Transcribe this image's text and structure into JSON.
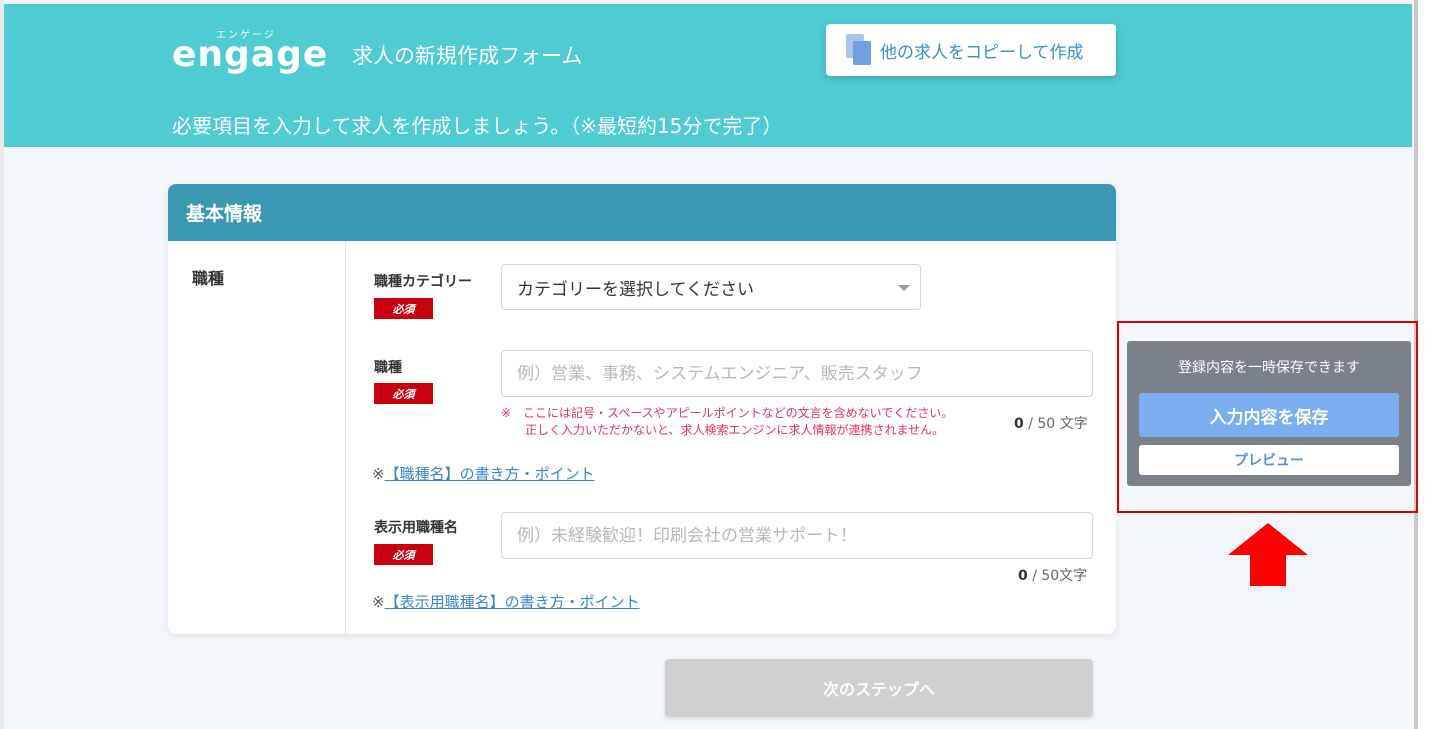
{
  "header": {
    "logo_kana": "エンゲージ",
    "logo_word": "engage",
    "title": "求人の新規作成フォーム",
    "subtitle": "必要項目を入力して求人を作成しましょう。（※最短約15分で完了）",
    "copy_button": "他の求人をコピーして作成"
  },
  "card": {
    "title": "基本情報",
    "side_label": "職種",
    "required_label": "必須",
    "category": {
      "label": "職種カテゴリー",
      "selected": "カテゴリーを選択してください"
    },
    "job_type": {
      "label": "職種",
      "placeholder": "例）営業、事務、システムエンジニア、販売スタッフ",
      "value": "",
      "warning_line1": "※　ここには記号・スペースやアピールポイントなどの文言を含めないでください。",
      "warning_line2": "正しく入力いただかないと、求人検索エンジンに求人情報が連携されません。",
      "count": "0",
      "count_max": "/ 50 文字",
      "guide_prefix": "※",
      "guide_link": "【職種名】の書き方・ポイント"
    },
    "display_job": {
      "label": "表示用職種名",
      "placeholder": "例）未経験歓迎！印刷会社の営業サポート！",
      "value": "",
      "count": "0",
      "count_max": "/ 50文字",
      "guide_prefix": "※",
      "guide_link": "【表示用職種名】の書き方・ポイント"
    }
  },
  "next_button": "次のステップへ",
  "save_panel": {
    "title": "登録内容を一時保存できます",
    "save_button": "入力内容を保存",
    "preview_button": "プレビュー"
  },
  "colors": {
    "header": "#4ecbd3",
    "card_head": "#3b98b3",
    "required": "#c9000d",
    "highlight": "#e00000"
  }
}
